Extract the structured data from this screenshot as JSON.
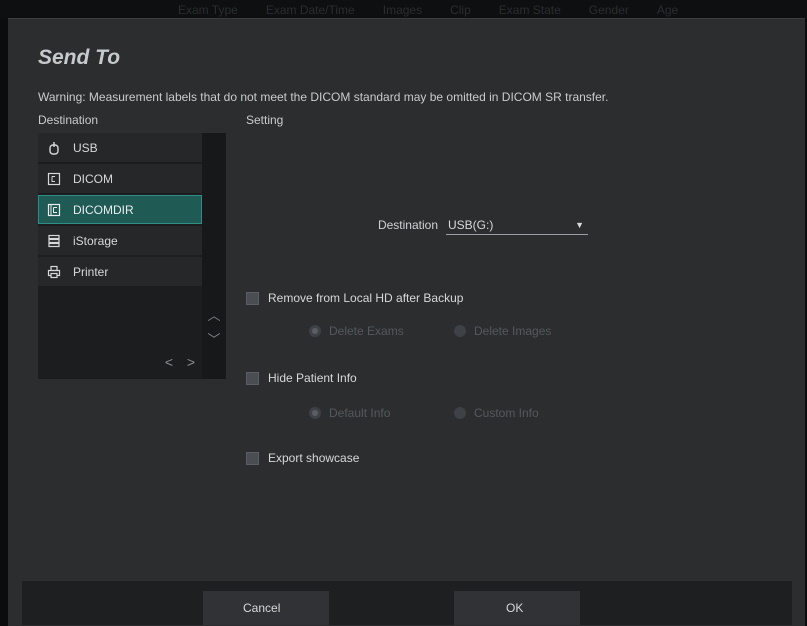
{
  "background": {
    "columns": [
      "Exam Type",
      "Exam Date/Time",
      "Images",
      "Clip",
      "Exam State",
      "Gender",
      "Age"
    ]
  },
  "dialog": {
    "title": "Send To",
    "warning": "Warning: Measurement labels that do not meet the DICOM standard may be omitted in DICOM SR transfer.",
    "destination_header": "Destination",
    "setting_header": "Setting"
  },
  "destinations": [
    {
      "label": "USB",
      "icon": "usb-icon",
      "selected": false
    },
    {
      "label": "DICOM",
      "icon": "dicom-icon",
      "selected": false
    },
    {
      "label": "DICOMDIR",
      "icon": "dicomdir-icon",
      "selected": true
    },
    {
      "label": "iStorage",
      "icon": "storage-icon",
      "selected": false
    },
    {
      "label": "Printer",
      "icon": "printer-icon",
      "selected": false
    }
  ],
  "settings": {
    "destination_label": "Destination",
    "destination_value": "USB(G:)",
    "remove_local": {
      "label": "Remove from Local HD after Backup",
      "checked": false
    },
    "remove_options": [
      {
        "label": "Delete Exams",
        "selected": true
      },
      {
        "label": "Delete Images",
        "selected": false
      }
    ],
    "hide_patient": {
      "label": "Hide Patient Info",
      "checked": false
    },
    "hide_options": [
      {
        "label": "Default Info",
        "selected": true
      },
      {
        "label": "Custom Info",
        "selected": false
      }
    ],
    "export_showcase": {
      "label": "Export showcase",
      "checked": false
    }
  },
  "buttons": {
    "cancel": "Cancel",
    "ok": "OK"
  },
  "colors": {
    "selected_bg": "#1f5a55",
    "selected_border": "#2f8f86",
    "dialog_bg": "#2b2d2f"
  }
}
